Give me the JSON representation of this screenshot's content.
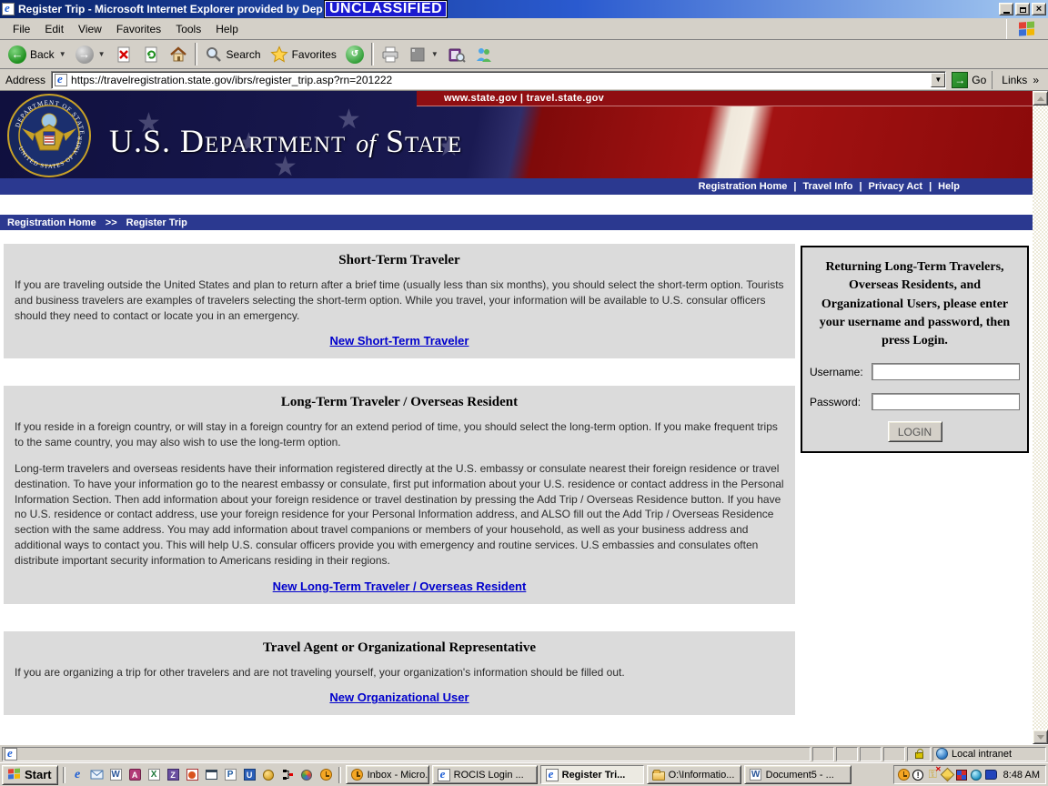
{
  "window": {
    "title": "Register Trip - Microsoft Internet Explorer provided by Dep",
    "classification_badge": "UNCLASSIFIED"
  },
  "menu_bar": {
    "items": [
      "File",
      "Edit",
      "View",
      "Favorites",
      "Tools",
      "Help"
    ]
  },
  "toolbar": {
    "back_label": "Back",
    "search_label": "Search",
    "favorites_label": "Favorites"
  },
  "address_bar": {
    "label": "Address",
    "url": "https://travelregistration.state.gov/ibrs/register_trip.asp?rn=201222",
    "go_label": "Go",
    "links_label": "Links",
    "links_chevron": "»"
  },
  "banner": {
    "top_links": "www.state.gov | travel.state.gov",
    "title_parts": {
      "left": "U.S. Department",
      "of": "of",
      "right": "State"
    },
    "seal_top_text": "DEPARTMENT OF STATE",
    "seal_bottom_text": "UNITED STATES OF AMERICA",
    "nav_links": [
      "Registration Home",
      "Travel Info",
      "Privacy Act",
      "Help"
    ],
    "nav_separator": "|"
  },
  "breadcrumb": {
    "home": "Registration Home",
    "separator": ">>",
    "current": "Register Trip"
  },
  "sections": {
    "short_term": {
      "title": "Short-Term Traveler",
      "body": "If you are traveling outside the United States and plan to return after a brief time (usually less than six months), you should select the short-term option. Tourists and business travelers are examples of travelers selecting the short-term option. While you travel, your information will be available to U.S. consular officers should they need to contact or locate you in an emergency.",
      "link": "New Short-Term Traveler"
    },
    "long_term": {
      "title": "Long-Term Traveler / Overseas Resident",
      "body1": "If you reside in a foreign country, or will stay in a foreign country for an extend period of time, you should select the long-term option. If you make frequent trips to the same country, you may also wish to use the long-term option.",
      "body2": "Long-term travelers and overseas residents have their information registered directly at the U.S. embassy or consulate nearest their foreign residence or travel destination. To have your information go to the nearest embassy or consulate, first put information about your U.S. residence or contact address in the Personal Information Section. Then add information about your foreign residence or travel destination by pressing the Add Trip / Overseas Residence button. If you have no U.S. residence or contact address, use your foreign residence for your Personal Information address, and ALSO fill out the Add Trip / Overseas Residence section with the same address. You may add information about travel companions or members of your household, as well as your business address and additional ways to contact you. This will help U.S. consular officers provide you with emergency and routine services. U.S embassies and consulates often distribute important security information to Americans residing in their regions.",
      "link": "New Long-Term Traveler / Overseas Resident"
    },
    "organizational": {
      "title": "Travel Agent or Organizational Representative",
      "body": "If you are organizing a trip for other travelers and are not traveling yourself, your organization's information should be filled out.",
      "link": "New Organizational User"
    }
  },
  "login_box": {
    "instructions": "Returning Long-Term Travelers, Overseas Residents, and Organizational Users, please enter your username and password, then press Login.",
    "username_label": "Username:",
    "password_label": "Password:",
    "username_value": "",
    "password_value": "",
    "login_button": "LOGIN"
  },
  "status_bar": {
    "zone": "Local intranet"
  },
  "taskbar": {
    "start_label": "Start",
    "quick_launch_icons": [
      "internet-explorer",
      "outlook-express",
      "word",
      "access",
      "excel",
      "frontpage",
      "app-orange",
      "show-desktop",
      "publisher",
      "app-blue",
      "msn",
      "org-chart",
      "media-player",
      "clock-app"
    ],
    "buttons": [
      {
        "label": "Inbox - Micro...",
        "icon": "outlook-clock"
      },
      {
        "label": "ROCIS Login ...",
        "icon": "internet-explorer"
      },
      {
        "label": "Register Tri...",
        "icon": "internet-explorer",
        "active": true
      },
      {
        "label": "O:\\Informatio...",
        "icon": "folder"
      },
      {
        "label": "Document5 - ...",
        "icon": "word"
      }
    ],
    "tray_icons": [
      "clock",
      "alert",
      "key-disabled",
      "pencil",
      "display-grid",
      "network",
      "address-book"
    ],
    "clock": "8:48 AM"
  },
  "colors": {
    "nav_bar_blue": "#2B3990",
    "banner_red": "#8F0E12",
    "link_blue": "#0000CC",
    "classification_bg": "#1A1AD0",
    "content_box_gray": "#DBDBDB"
  }
}
